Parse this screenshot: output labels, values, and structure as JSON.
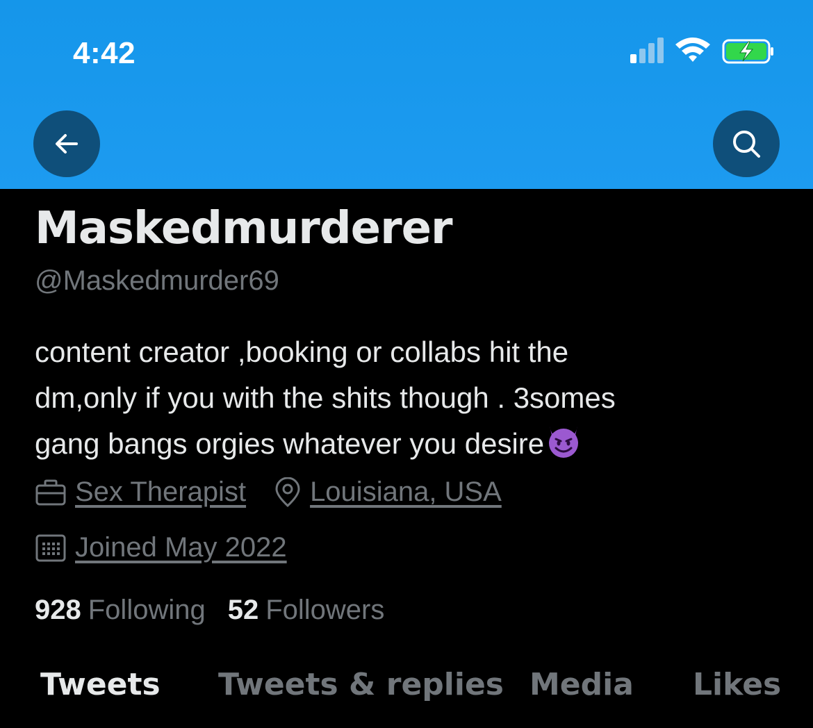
{
  "status_bar": {
    "time": "4:42",
    "icons": [
      "signal-icon",
      "wifi-icon",
      "battery-charging-icon"
    ]
  },
  "header": {
    "back_icon": "back-arrow-icon",
    "search_icon": "search-icon",
    "accent_color": "#1d9bf0"
  },
  "profile": {
    "display_name": "Maskedmurderer",
    "handle": "@Maskedmurder69",
    "bio_lines": [
      "content creator ,booking or collabs hit the",
      "dm,only if you with the shits though . 3somes",
      "gang bangs orgies whatever you desire"
    ],
    "bio_emoji": "smiling-devil-emoji",
    "profession": "Sex Therapist",
    "location": "Louisiana, USA",
    "joined": "Joined May 2022",
    "following_count": "928",
    "following_label": "Following",
    "followers_count": "52",
    "followers_label": "Followers"
  },
  "tabs": [
    {
      "label": "Tweets",
      "active": true
    },
    {
      "label": "Tweets & replies",
      "active": false
    },
    {
      "label": "Media",
      "active": false
    },
    {
      "label": "Likes",
      "active": false
    }
  ]
}
